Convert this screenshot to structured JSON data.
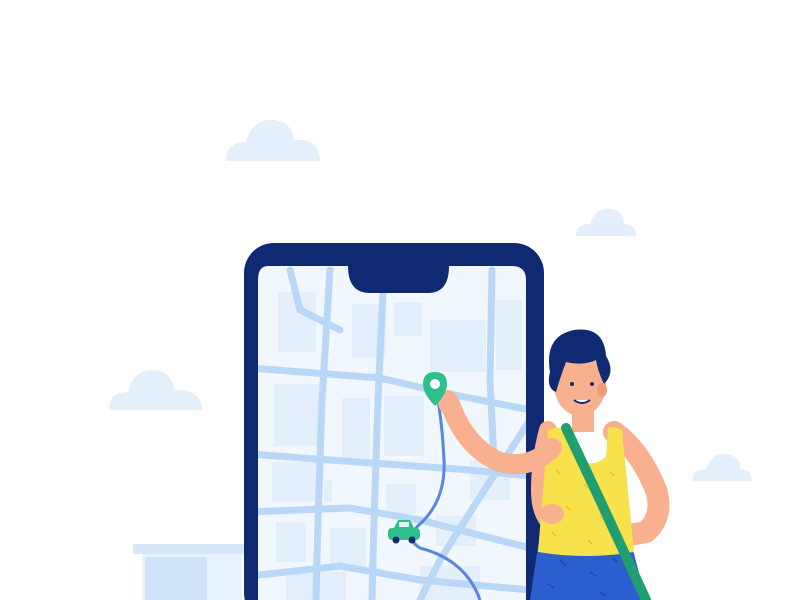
{
  "illustration": {
    "subject": "map-navigation",
    "colors": {
      "background": "#ffffff",
      "cloud": "#e3f0fc",
      "phone_frame": "#0f2a72",
      "map_background": "#f1f7fe",
      "map_block": "#e4effc",
      "map_road": "#b9d8f8",
      "route": "#5b86e0",
      "pin": "#2fbf8a",
      "car": "#2fbf8a",
      "skin": "#f8b08f",
      "hair": "#0f2a72",
      "top": "#f7e24b",
      "strap": "#1f9e6f",
      "pants": "#2b5fcf",
      "building": "#dbecfb"
    },
    "icons": [
      "map-pin-icon",
      "car-icon"
    ]
  }
}
